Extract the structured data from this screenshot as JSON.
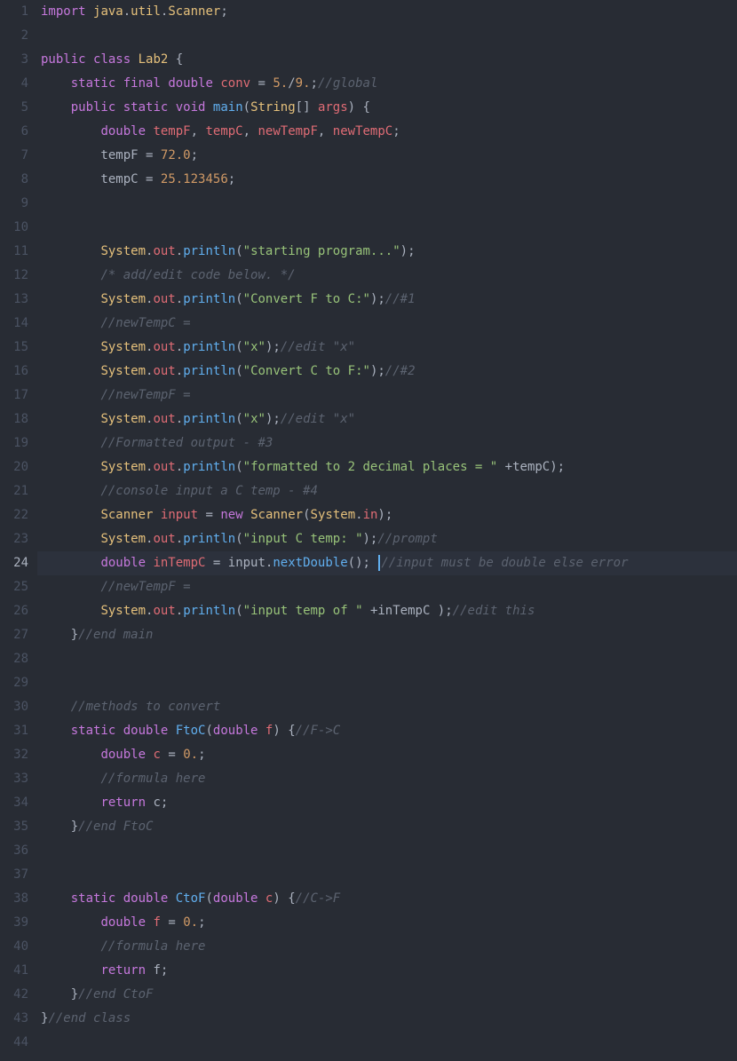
{
  "editor": {
    "activeLine": 24,
    "lines": [
      {
        "n": 1,
        "seg": [
          [
            "kw",
            "import"
          ],
          [
            "pln",
            " "
          ],
          [
            "klass",
            "java"
          ],
          [
            "pln",
            "."
          ],
          [
            "klass",
            "util"
          ],
          [
            "pln",
            "."
          ],
          [
            "klass",
            "Scanner"
          ],
          [
            "pln",
            ";"
          ]
        ]
      },
      {
        "n": 2,
        "seg": []
      },
      {
        "n": 3,
        "seg": [
          [
            "kw",
            "public"
          ],
          [
            "pln",
            " "
          ],
          [
            "kw",
            "class"
          ],
          [
            "pln",
            " "
          ],
          [
            "klass",
            "Lab2"
          ],
          [
            "pln",
            " {"
          ]
        ]
      },
      {
        "n": 4,
        "seg": [
          [
            "pln",
            "    "
          ],
          [
            "kw",
            "static"
          ],
          [
            "pln",
            " "
          ],
          [
            "kw",
            "final"
          ],
          [
            "pln",
            " "
          ],
          [
            "kw",
            "double"
          ],
          [
            "pln",
            " "
          ],
          [
            "red",
            "conv"
          ],
          [
            "pln",
            " "
          ],
          [
            "pln",
            "="
          ],
          [
            "pln",
            " "
          ],
          [
            "num",
            "5."
          ],
          [
            "pln",
            "/"
          ],
          [
            "num",
            "9."
          ],
          [
            "pln",
            ";"
          ],
          [
            "cmt",
            "//global"
          ]
        ]
      },
      {
        "n": 5,
        "seg": [
          [
            "pln",
            "    "
          ],
          [
            "kw",
            "public"
          ],
          [
            "pln",
            " "
          ],
          [
            "kw",
            "static"
          ],
          [
            "pln",
            " "
          ],
          [
            "kw",
            "void"
          ],
          [
            "pln",
            " "
          ],
          [
            "fn",
            "main"
          ],
          [
            "pln",
            "("
          ],
          [
            "klass",
            "String"
          ],
          [
            "pln",
            "[] "
          ],
          [
            "red",
            "args"
          ],
          [
            "pln",
            ") {"
          ]
        ]
      },
      {
        "n": 6,
        "seg": [
          [
            "pln",
            "        "
          ],
          [
            "kw",
            "double"
          ],
          [
            "pln",
            " "
          ],
          [
            "red",
            "tempF"
          ],
          [
            "pln",
            ", "
          ],
          [
            "red",
            "tempC"
          ],
          [
            "pln",
            ", "
          ],
          [
            "red",
            "newTempF"
          ],
          [
            "pln",
            ", "
          ],
          [
            "red",
            "newTempC"
          ],
          [
            "pln",
            ";"
          ]
        ]
      },
      {
        "n": 7,
        "seg": [
          [
            "pln",
            "        tempF "
          ],
          [
            "pln",
            "="
          ],
          [
            "pln",
            " "
          ],
          [
            "num",
            "72.0"
          ],
          [
            "pln",
            ";"
          ]
        ]
      },
      {
        "n": 8,
        "seg": [
          [
            "pln",
            "        tempC "
          ],
          [
            "pln",
            "="
          ],
          [
            "pln",
            " "
          ],
          [
            "num",
            "25.123456"
          ],
          [
            "pln",
            ";"
          ]
        ]
      },
      {
        "n": 9,
        "seg": []
      },
      {
        "n": 10,
        "seg": []
      },
      {
        "n": 11,
        "seg": [
          [
            "pln",
            "        "
          ],
          [
            "klass",
            "System"
          ],
          [
            "pln",
            "."
          ],
          [
            "red",
            "out"
          ],
          [
            "pln",
            "."
          ],
          [
            "fn",
            "println"
          ],
          [
            "pln",
            "("
          ],
          [
            "str",
            "\"starting program...\""
          ],
          [
            "pln",
            ");"
          ]
        ]
      },
      {
        "n": 12,
        "seg": [
          [
            "pln",
            "        "
          ],
          [
            "cmt",
            "/* add/edit code below. */"
          ]
        ]
      },
      {
        "n": 13,
        "seg": [
          [
            "pln",
            "        "
          ],
          [
            "klass",
            "System"
          ],
          [
            "pln",
            "."
          ],
          [
            "red",
            "out"
          ],
          [
            "pln",
            "."
          ],
          [
            "fn",
            "println"
          ],
          [
            "pln",
            "("
          ],
          [
            "str",
            "\"Convert F to C:\""
          ],
          [
            "pln",
            ");"
          ],
          [
            "cmt",
            "//#1"
          ]
        ]
      },
      {
        "n": 14,
        "seg": [
          [
            "pln",
            "        "
          ],
          [
            "cmt",
            "//newTempC ="
          ]
        ]
      },
      {
        "n": 15,
        "seg": [
          [
            "pln",
            "        "
          ],
          [
            "klass",
            "System"
          ],
          [
            "pln",
            "."
          ],
          [
            "red",
            "out"
          ],
          [
            "pln",
            "."
          ],
          [
            "fn",
            "println"
          ],
          [
            "pln",
            "("
          ],
          [
            "str",
            "\"x\""
          ],
          [
            "pln",
            ");"
          ],
          [
            "cmt",
            "//edit \"x\""
          ]
        ]
      },
      {
        "n": 16,
        "seg": [
          [
            "pln",
            "        "
          ],
          [
            "klass",
            "System"
          ],
          [
            "pln",
            "."
          ],
          [
            "red",
            "out"
          ],
          [
            "pln",
            "."
          ],
          [
            "fn",
            "println"
          ],
          [
            "pln",
            "("
          ],
          [
            "str",
            "\"Convert C to F:\""
          ],
          [
            "pln",
            ");"
          ],
          [
            "cmt",
            "//#2"
          ]
        ]
      },
      {
        "n": 17,
        "seg": [
          [
            "pln",
            "        "
          ],
          [
            "cmt",
            "//newTempF ="
          ]
        ]
      },
      {
        "n": 18,
        "seg": [
          [
            "pln",
            "        "
          ],
          [
            "klass",
            "System"
          ],
          [
            "pln",
            "."
          ],
          [
            "red",
            "out"
          ],
          [
            "pln",
            "."
          ],
          [
            "fn",
            "println"
          ],
          [
            "pln",
            "("
          ],
          [
            "str",
            "\"x\""
          ],
          [
            "pln",
            ");"
          ],
          [
            "cmt",
            "//edit \"x\""
          ]
        ]
      },
      {
        "n": 19,
        "seg": [
          [
            "pln",
            "        "
          ],
          [
            "cmt",
            "//Formatted output - #3"
          ]
        ]
      },
      {
        "n": 20,
        "seg": [
          [
            "pln",
            "        "
          ],
          [
            "klass",
            "System"
          ],
          [
            "pln",
            "."
          ],
          [
            "red",
            "out"
          ],
          [
            "pln",
            "."
          ],
          [
            "fn",
            "println"
          ],
          [
            "pln",
            "("
          ],
          [
            "str",
            "\"formatted to 2 decimal places = \""
          ],
          [
            "pln",
            " "
          ],
          [
            "pln",
            "+"
          ],
          [
            "pln",
            "tempC);"
          ]
        ]
      },
      {
        "n": 21,
        "seg": [
          [
            "pln",
            "        "
          ],
          [
            "cmt",
            "//console input a C temp - #4"
          ]
        ]
      },
      {
        "n": 22,
        "seg": [
          [
            "pln",
            "        "
          ],
          [
            "klass",
            "Scanner"
          ],
          [
            "pln",
            " "
          ],
          [
            "red",
            "input"
          ],
          [
            "pln",
            " "
          ],
          [
            "pln",
            "="
          ],
          [
            "pln",
            " "
          ],
          [
            "kw",
            "new"
          ],
          [
            "pln",
            " "
          ],
          [
            "klass",
            "Scanner"
          ],
          [
            "pln",
            "("
          ],
          [
            "klass",
            "System"
          ],
          [
            "pln",
            "."
          ],
          [
            "red",
            "in"
          ],
          [
            "pln",
            ");"
          ]
        ]
      },
      {
        "n": 23,
        "seg": [
          [
            "pln",
            "        "
          ],
          [
            "klass",
            "System"
          ],
          [
            "pln",
            "."
          ],
          [
            "red",
            "out"
          ],
          [
            "pln",
            "."
          ],
          [
            "fn",
            "println"
          ],
          [
            "pln",
            "("
          ],
          [
            "str",
            "\"input C temp: \""
          ],
          [
            "pln",
            ");"
          ],
          [
            "cmt",
            "//prompt"
          ]
        ]
      },
      {
        "n": 24,
        "seg": [
          [
            "pln",
            "        "
          ],
          [
            "kw",
            "double"
          ],
          [
            "pln",
            " "
          ],
          [
            "red",
            "inTempC"
          ],
          [
            "pln",
            " "
          ],
          [
            "pln",
            "="
          ],
          [
            "pln",
            " input."
          ],
          [
            "fn",
            "nextDouble"
          ],
          [
            "pln",
            "(); "
          ],
          [
            "cursor",
            ""
          ],
          [
            "cmt",
            "//input must be double else error"
          ]
        ]
      },
      {
        "n": 25,
        "seg": [
          [
            "pln",
            "        "
          ],
          [
            "cmt",
            "//newTempF ="
          ]
        ]
      },
      {
        "n": 26,
        "seg": [
          [
            "pln",
            "        "
          ],
          [
            "klass",
            "System"
          ],
          [
            "pln",
            "."
          ],
          [
            "red",
            "out"
          ],
          [
            "pln",
            "."
          ],
          [
            "fn",
            "println"
          ],
          [
            "pln",
            "("
          ],
          [
            "str",
            "\"input temp of \""
          ],
          [
            "pln",
            " "
          ],
          [
            "pln",
            "+"
          ],
          [
            "pln",
            "inTempC );"
          ],
          [
            "cmt",
            "//edit this"
          ]
        ]
      },
      {
        "n": 27,
        "seg": [
          [
            "pln",
            "    }"
          ],
          [
            "cmt",
            "//end main"
          ]
        ]
      },
      {
        "n": 28,
        "seg": []
      },
      {
        "n": 29,
        "seg": []
      },
      {
        "n": 30,
        "seg": [
          [
            "pln",
            "    "
          ],
          [
            "cmt",
            "//methods to convert"
          ]
        ]
      },
      {
        "n": 31,
        "seg": [
          [
            "pln",
            "    "
          ],
          [
            "kw",
            "static"
          ],
          [
            "pln",
            " "
          ],
          [
            "kw",
            "double"
          ],
          [
            "pln",
            " "
          ],
          [
            "fn",
            "FtoC"
          ],
          [
            "pln",
            "("
          ],
          [
            "kw",
            "double"
          ],
          [
            "pln",
            " "
          ],
          [
            "red",
            "f"
          ],
          [
            "pln",
            ") {"
          ],
          [
            "cmt",
            "//F->C"
          ]
        ]
      },
      {
        "n": 32,
        "seg": [
          [
            "pln",
            "        "
          ],
          [
            "kw",
            "double"
          ],
          [
            "pln",
            " "
          ],
          [
            "red",
            "c"
          ],
          [
            "pln",
            " "
          ],
          [
            "pln",
            "="
          ],
          [
            "pln",
            " "
          ],
          [
            "num",
            "0."
          ],
          [
            "pln",
            ";"
          ]
        ]
      },
      {
        "n": 33,
        "seg": [
          [
            "pln",
            "        "
          ],
          [
            "cmt",
            "//formula here"
          ]
        ]
      },
      {
        "n": 34,
        "seg": [
          [
            "pln",
            "        "
          ],
          [
            "kw",
            "return"
          ],
          [
            "pln",
            " c;"
          ]
        ]
      },
      {
        "n": 35,
        "seg": [
          [
            "pln",
            "    }"
          ],
          [
            "cmt",
            "//end FtoC"
          ]
        ]
      },
      {
        "n": 36,
        "seg": []
      },
      {
        "n": 37,
        "seg": []
      },
      {
        "n": 38,
        "seg": [
          [
            "pln",
            "    "
          ],
          [
            "kw",
            "static"
          ],
          [
            "pln",
            " "
          ],
          [
            "kw",
            "double"
          ],
          [
            "pln",
            " "
          ],
          [
            "fn",
            "CtoF"
          ],
          [
            "pln",
            "("
          ],
          [
            "kw",
            "double"
          ],
          [
            "pln",
            " "
          ],
          [
            "red",
            "c"
          ],
          [
            "pln",
            ") {"
          ],
          [
            "cmt",
            "//C->F"
          ]
        ]
      },
      {
        "n": 39,
        "seg": [
          [
            "pln",
            "        "
          ],
          [
            "kw",
            "double"
          ],
          [
            "pln",
            " "
          ],
          [
            "red",
            "f"
          ],
          [
            "pln",
            " "
          ],
          [
            "pln",
            "="
          ],
          [
            "pln",
            " "
          ],
          [
            "num",
            "0."
          ],
          [
            "pln",
            ";"
          ]
        ]
      },
      {
        "n": 40,
        "seg": [
          [
            "pln",
            "        "
          ],
          [
            "cmt",
            "//formula here"
          ]
        ]
      },
      {
        "n": 41,
        "seg": [
          [
            "pln",
            "        "
          ],
          [
            "kw",
            "return"
          ],
          [
            "pln",
            " f;"
          ]
        ]
      },
      {
        "n": 42,
        "seg": [
          [
            "pln",
            "    }"
          ],
          [
            "cmt",
            "//end CtoF"
          ]
        ]
      },
      {
        "n": 43,
        "seg": [
          [
            "pln",
            "}"
          ],
          [
            "cmt",
            "//end class"
          ]
        ]
      },
      {
        "n": 44,
        "seg": []
      }
    ]
  }
}
